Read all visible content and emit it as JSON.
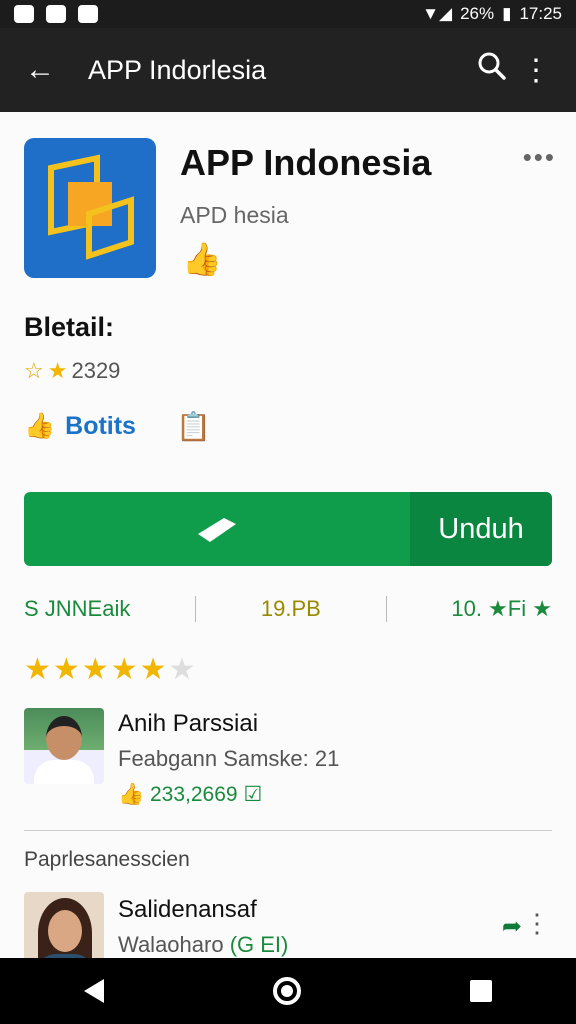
{
  "status": {
    "battery": "26%",
    "time": "17:25"
  },
  "appbar": {
    "title": "APP Indorlesia"
  },
  "app": {
    "name": "APP Indonesia",
    "developer": "APD hesia",
    "more": "•••"
  },
  "detail": {
    "label": "Bletail:",
    "rating_text": "2329",
    "link_label": "Botits"
  },
  "install": {
    "label": "Unduh"
  },
  "stats": {
    "downloads": "S JNNEaik",
    "size": "19.PB",
    "rating": "10. ★Fi ★"
  },
  "rating_stars": {
    "filled": 5,
    "total": 6
  },
  "reviews": [
    {
      "name": "Anih Parssiai",
      "meta": "Feabgann Samske: 21",
      "count": "233,2669"
    }
  ],
  "section": {
    "title": "Paprlesanesscien"
  },
  "review2": {
    "name": "Salidenansaf",
    "meta_prefix": "Walaoharo",
    "meta_green": "(G EI)"
  },
  "colors": {
    "primary_green": "#0f9d4c",
    "appbar": "#222222",
    "star": "#f2b600"
  },
  "icons": [
    "back-arrow-icon",
    "search-icon",
    "more-vert-icon",
    "thumbs-up-icon",
    "clipboard-icon",
    "tag-icon",
    "share-icon"
  ]
}
